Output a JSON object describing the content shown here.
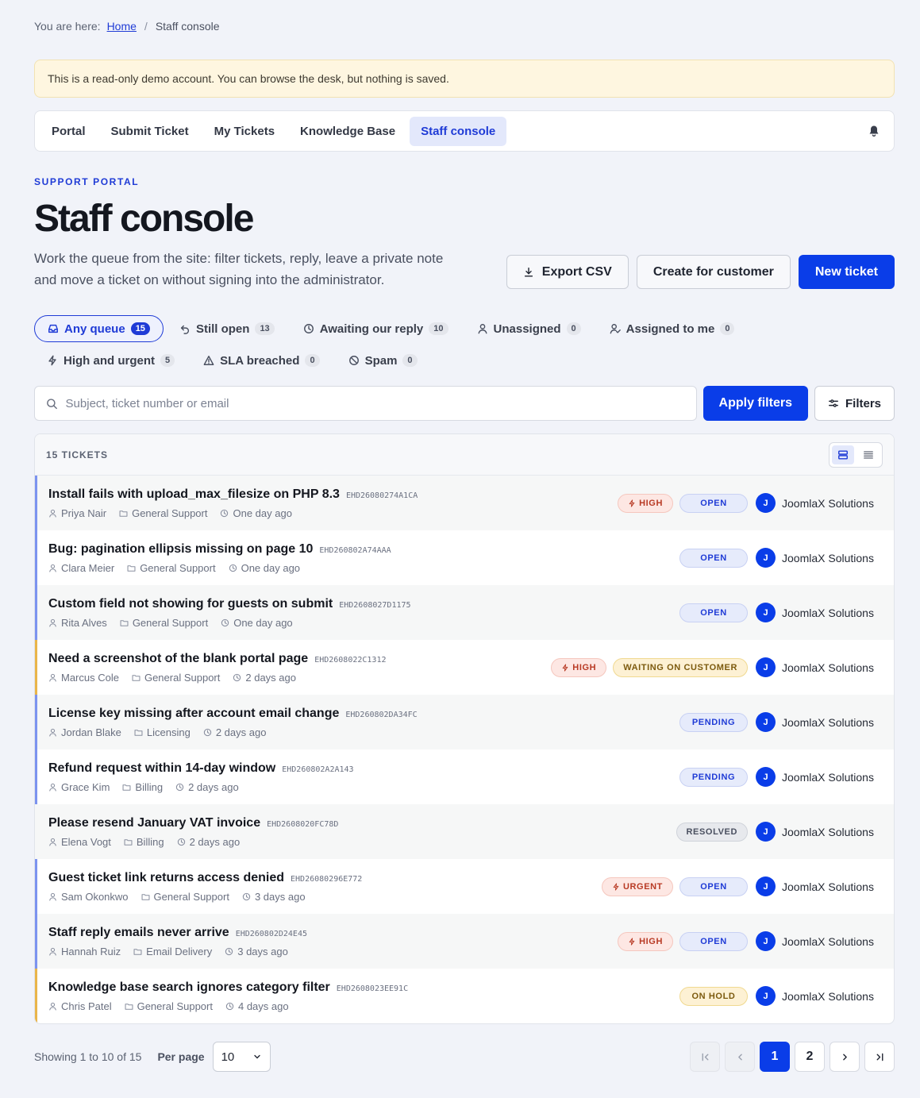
{
  "breadcrumb": {
    "prefix": "You are here:",
    "home": "Home",
    "current": "Staff console"
  },
  "notice": "This is a read-only demo account. You can browse the desk, but nothing is saved.",
  "nav": {
    "items": [
      {
        "label": "Portal",
        "active": false
      },
      {
        "label": "Submit Ticket",
        "active": false
      },
      {
        "label": "My Tickets",
        "active": false
      },
      {
        "label": "Knowledge Base",
        "active": false
      },
      {
        "label": "Staff console",
        "active": true
      }
    ],
    "bell_icon": "bell-icon"
  },
  "hero": {
    "kicker": "SUPPORT PORTAL",
    "title": "Staff console",
    "subtitle": "Work the queue from the site: filter tickets, reply, leave a private note and move a ticket on without signing into the administrator.",
    "export_label": "Export CSV",
    "create_label": "Create for customer",
    "new_label": "New ticket"
  },
  "chips": {
    "row1": [
      {
        "label": "Any queue",
        "count": "15",
        "icon": "inbox-icon",
        "active": true
      },
      {
        "label": "Still open",
        "count": "13",
        "icon": "reopen-icon",
        "active": false
      },
      {
        "label": "Awaiting our reply",
        "count": "10",
        "icon": "clock-icon",
        "active": false
      },
      {
        "label": "Unassigned",
        "count": "0",
        "icon": "user-icon",
        "active": false
      },
      {
        "label": "Assigned to me",
        "count": "0",
        "icon": "user-check-icon",
        "active": false
      }
    ],
    "row2": [
      {
        "label": "High and urgent",
        "count": "5",
        "icon": "bolt-icon",
        "active": false
      },
      {
        "label": "SLA breached",
        "count": "0",
        "icon": "warning-icon",
        "active": false
      },
      {
        "label": "Spam",
        "count": "0",
        "icon": "ban-icon",
        "active": false
      }
    ]
  },
  "search": {
    "placeholder": "Subject, ticket number or email",
    "value": "",
    "apply_label": "Apply filters",
    "filters_label": "Filters"
  },
  "list": {
    "count_label": "15 TICKETS",
    "rows": [
      {
        "subject": "Install fails with upload_max_filesize on PHP 8.3",
        "id": "EHD26080274A1CA",
        "customer": "Priya Nair",
        "category": "General Support",
        "time": "One day ago",
        "priority": "HIGH",
        "status": "OPEN",
        "status_kind": "open",
        "assignee": "JoomlaX Solutions",
        "avatar": "J",
        "bar": "#7c93ef",
        "alt": true
      },
      {
        "subject": "Bug: pagination ellipsis missing on page 10",
        "id": "EHD260802A74AAA",
        "customer": "Clara Meier",
        "category": "General Support",
        "time": "One day ago",
        "priority": "",
        "status": "OPEN",
        "status_kind": "open",
        "assignee": "JoomlaX Solutions",
        "avatar": "J",
        "bar": "#7c93ef",
        "alt": false
      },
      {
        "subject": "Custom field not showing for guests on submit",
        "id": "EHD2608027D1175",
        "customer": "Rita Alves",
        "category": "General Support",
        "time": "One day ago",
        "priority": "",
        "status": "OPEN",
        "status_kind": "open",
        "assignee": "JoomlaX Solutions",
        "avatar": "J",
        "bar": "#7c93ef",
        "alt": true
      },
      {
        "subject": "Need a screenshot of the blank portal page",
        "id": "EHD2608022C1312",
        "customer": "Marcus Cole",
        "category": "General Support",
        "time": "2 days ago",
        "priority": "HIGH",
        "status": "WAITING ON CUSTOMER",
        "status_kind": "waiting",
        "assignee": "JoomlaX Solutions",
        "avatar": "J",
        "bar": "#e9b54a",
        "alt": false
      },
      {
        "subject": "License key missing after account email change",
        "id": "EHD260802DA34FC",
        "customer": "Jordan Blake",
        "category": "Licensing",
        "time": "2 days ago",
        "priority": "",
        "status": "PENDING",
        "status_kind": "pending",
        "assignee": "JoomlaX Solutions",
        "avatar": "J",
        "bar": "#7c93ef",
        "alt": true
      },
      {
        "subject": "Refund request within 14-day window",
        "id": "EHD260802A2A143",
        "customer": "Grace Kim",
        "category": "Billing",
        "time": "2 days ago",
        "priority": "",
        "status": "PENDING",
        "status_kind": "pending",
        "assignee": "JoomlaX Solutions",
        "avatar": "J",
        "bar": "#7c93ef",
        "alt": false
      },
      {
        "subject": "Please resend January VAT invoice",
        "id": "EHD2608020FC78D",
        "customer": "Elena Vogt",
        "category": "Billing",
        "time": "2 days ago",
        "priority": "",
        "status": "RESOLVED",
        "status_kind": "resolved",
        "assignee": "JoomlaX Solutions",
        "avatar": "J",
        "bar": "",
        "alt": true
      },
      {
        "subject": "Guest ticket link returns access denied",
        "id": "EHD26080296E772",
        "customer": "Sam Okonkwo",
        "category": "General Support",
        "time": "3 days ago",
        "priority": "URGENT",
        "status": "OPEN",
        "status_kind": "open",
        "assignee": "JoomlaX Solutions",
        "avatar": "J",
        "bar": "#7c93ef",
        "alt": false
      },
      {
        "subject": "Staff reply emails never arrive",
        "id": "EHD260802D24E45",
        "customer": "Hannah Ruiz",
        "category": "Email Delivery",
        "time": "3 days ago",
        "priority": "HIGH",
        "status": "OPEN",
        "status_kind": "open",
        "assignee": "JoomlaX Solutions",
        "avatar": "J",
        "bar": "#7c93ef",
        "alt": true
      },
      {
        "subject": "Knowledge base search ignores category filter",
        "id": "EHD2608023EE91C",
        "customer": "Chris Patel",
        "category": "General Support",
        "time": "4 days ago",
        "priority": "",
        "status": "ON HOLD",
        "status_kind": "hold",
        "assignee": "JoomlaX Solutions",
        "avatar": "J",
        "bar": "#e9b54a",
        "alt": false
      }
    ]
  },
  "footer": {
    "showing": "Showing 1 to 10 of 15",
    "perpage_label": "Per page",
    "perpage_value": "10",
    "pages": [
      "1",
      "2"
    ],
    "current_page": "1"
  }
}
